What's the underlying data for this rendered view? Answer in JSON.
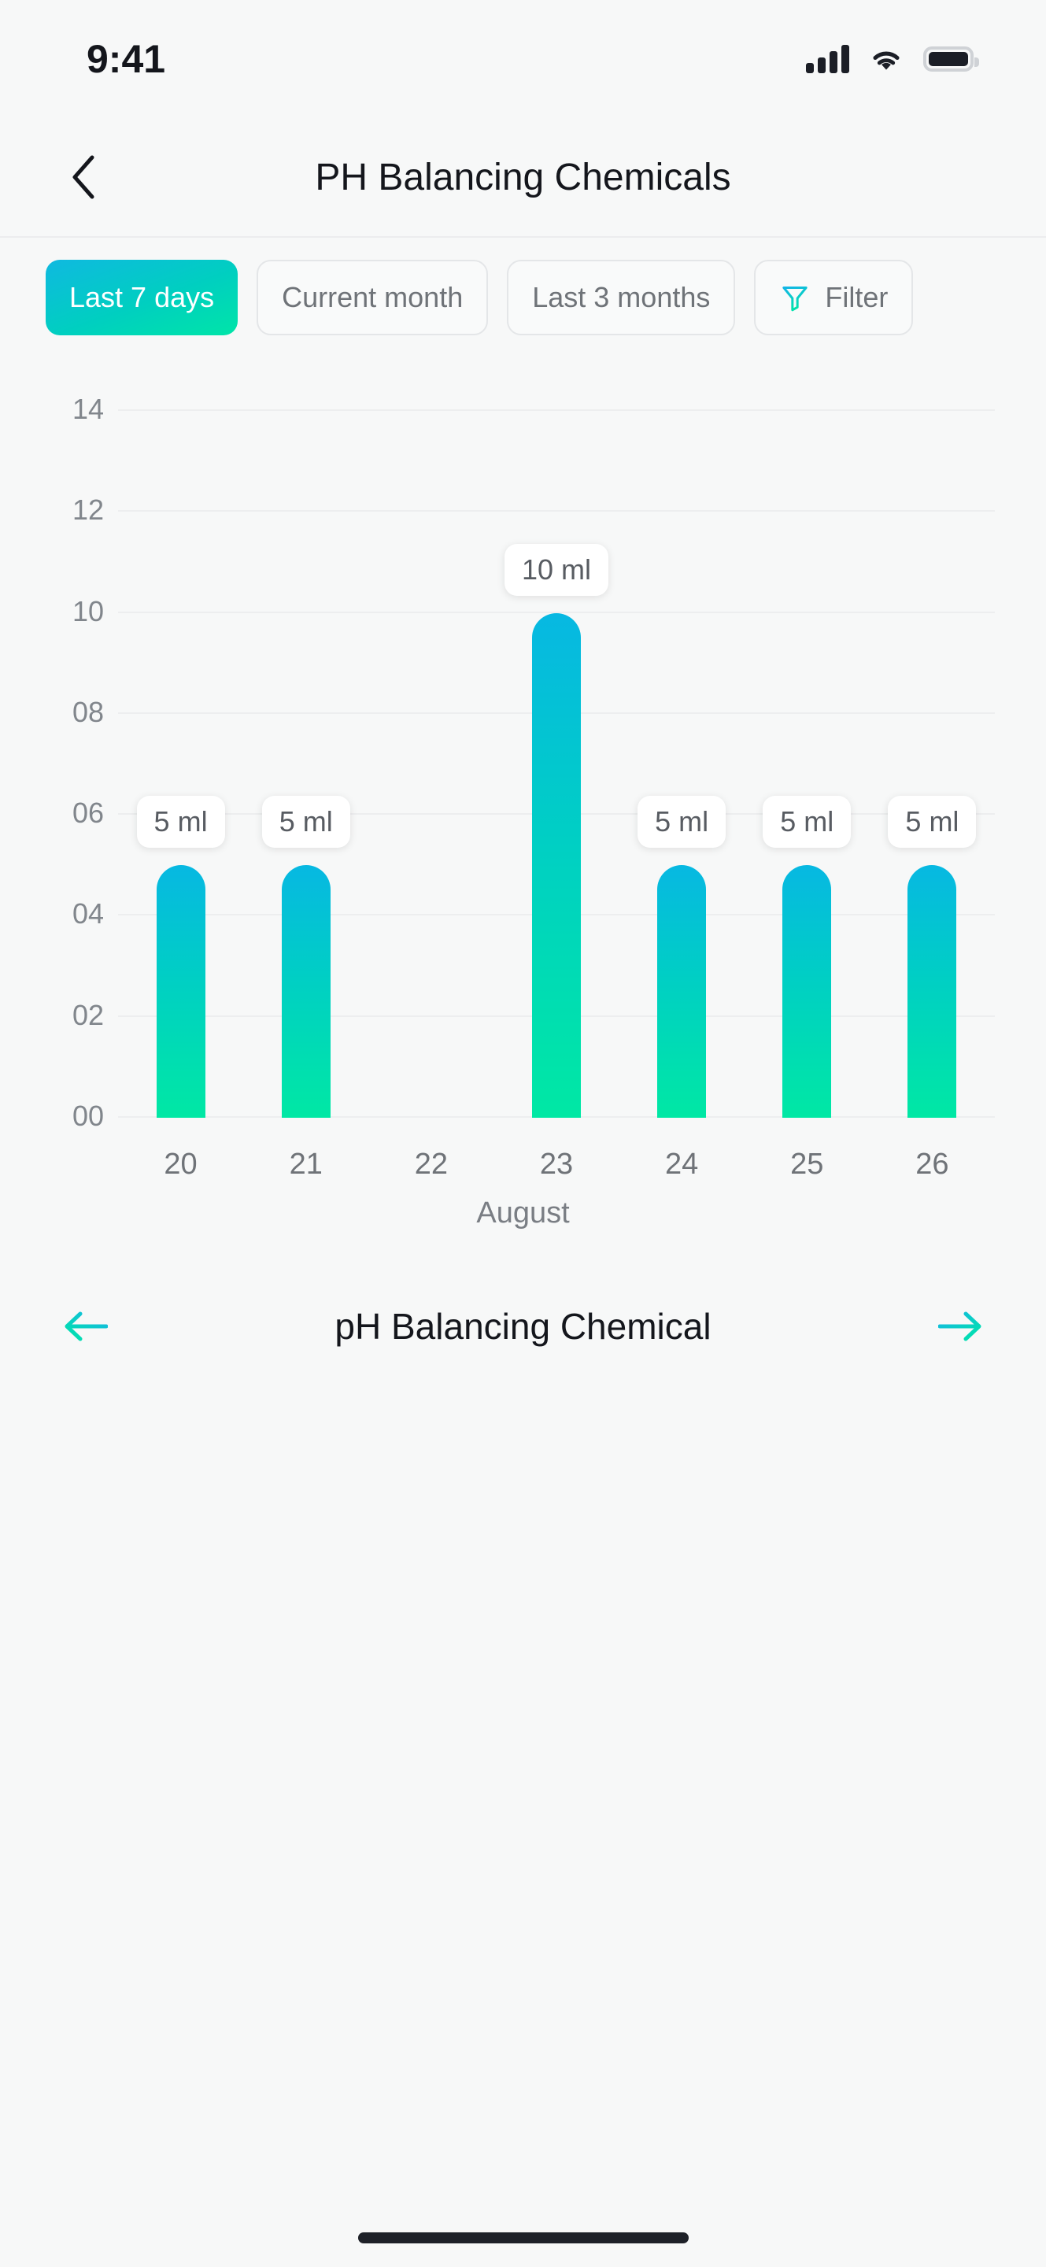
{
  "status_bar": {
    "time": "9:41",
    "icons": [
      "cellular-signal-icon",
      "wifi-icon",
      "battery-icon"
    ]
  },
  "header": {
    "back_icon": "chevron-left-icon",
    "title": "PH Balancing Chemicals"
  },
  "filters": {
    "chips": [
      {
        "label": "Last 7 days",
        "active": true
      },
      {
        "label": "Current month",
        "active": false
      },
      {
        "label": "Last 3 months",
        "active": false
      }
    ],
    "filter_button": {
      "label": "Filter",
      "icon": "funnel-icon"
    }
  },
  "pager": {
    "prev_icon": "arrow-left-icon",
    "title": "pH Balancing Chemical",
    "next_icon": "arrow-right-icon"
  },
  "colors": {
    "accent_cyan": "#07b8e2",
    "accent_green": "#00e8a4",
    "background": "#f7f8f8",
    "text_primary": "#14161c",
    "text_muted": "#6f7378",
    "grid": "#edeeef"
  },
  "chart_data": {
    "type": "bar",
    "title": "",
    "xlabel": "August",
    "ylabel": "",
    "categories": [
      "20",
      "21",
      "22",
      "23",
      "24",
      "25",
      "26"
    ],
    "values": [
      5,
      5,
      0,
      10,
      5,
      5,
      5
    ],
    "data_labels": [
      "5 ml",
      "5 ml",
      "",
      "10 ml",
      "5 ml",
      "5 ml",
      "5 ml"
    ],
    "unit": "ml",
    "ylim": [
      0,
      14
    ],
    "yticks": [
      "00",
      "02",
      "04",
      "06",
      "08",
      "10",
      "12",
      "14"
    ],
    "ytick_values": [
      0,
      2,
      4,
      6,
      8,
      10,
      12,
      14
    ],
    "grid": true,
    "legend": "none"
  }
}
